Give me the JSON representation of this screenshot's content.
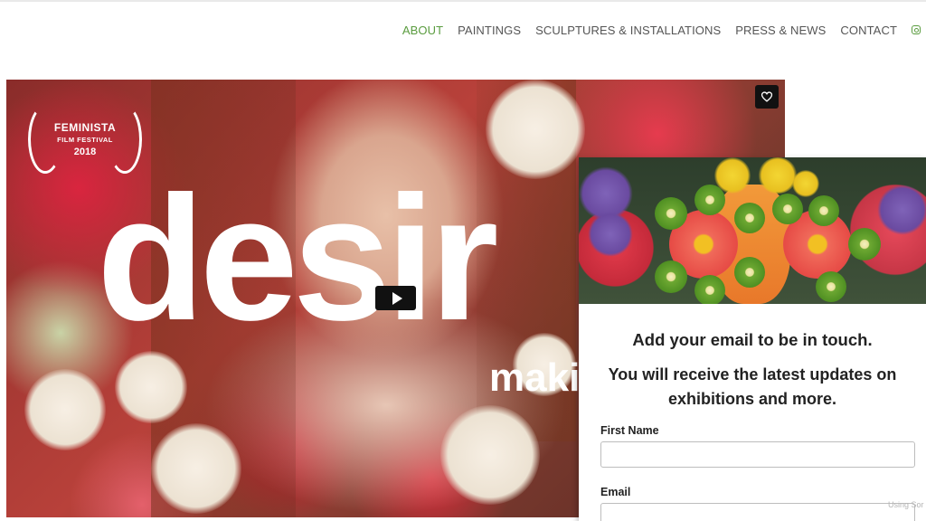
{
  "nav": {
    "items": [
      "ABOUT",
      "PAINTINGS",
      "SCULPTURES & INSTALLATIONS",
      "PRESS & NEWS",
      "CONTACT"
    ],
    "active": "ABOUT",
    "accent_color": "#5a9c3f",
    "social_icon": "instagram-icon"
  },
  "hero": {
    "badge": {
      "line1": "FEMINISTA",
      "line2": "FILM FESTIVAL",
      "line3": "2018"
    },
    "title_big": "desir",
    "title_small": "maki",
    "favorite_icon": "heart-icon",
    "play_icon": "play-icon"
  },
  "signup": {
    "heading": "Add your email to be in touch.",
    "subheading": "You will receive the latest updates on exhibitions and more.",
    "first_name_label": "First Name",
    "first_name_value": "",
    "email_label": "Email",
    "email_value": "",
    "footer_note": "Using Sor"
  }
}
